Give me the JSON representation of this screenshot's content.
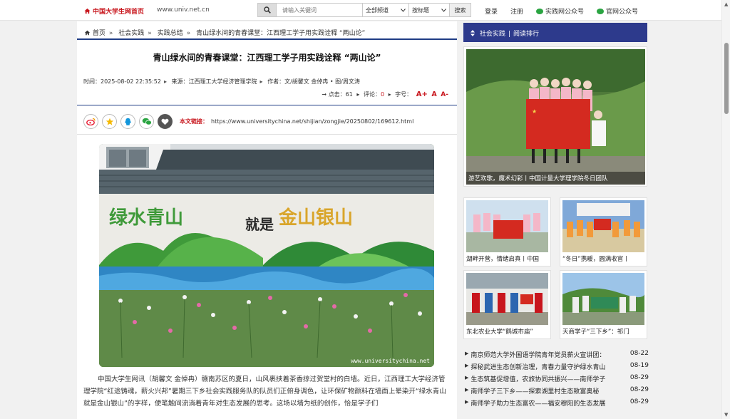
{
  "topbar": {
    "home_label": "中国大学生网首页",
    "domain": "www.univ.net.cn",
    "search_placeholder": "请输入关键词",
    "channel_select": "全部频道",
    "field_select": "按标题",
    "search_button": "搜索",
    "login": "登录",
    "register": "注册",
    "wechat_practice": "实践网公众号",
    "wechat_official": "官网公众号"
  },
  "breadcrumb": {
    "home": "首页",
    "c1": "社会实践",
    "c2": "实践总结",
    "current": "青山绿水间的青春课堂：江西理工学子用实践诠释 “两山论”"
  },
  "article": {
    "title": "青山绿水间的青春课堂：江西理工学子用实践诠释 “两山论”",
    "time": "时间：2025-08-02 22:35:52",
    "source": "来源：江西理工大学经济管理学院",
    "author": "作者：文/胡馨文 金倬冉 • 图/周文涛",
    "clicks_label": "点击：",
    "clicks": "61",
    "comments_label": "评论：",
    "comments": "0",
    "font_label": "字号：",
    "font_large": "A+",
    "font_mid": "A",
    "font_small": "A-",
    "link_label": "本文链接：",
    "link_url": "https://www.universitychina.net/shijian/zongjie/20250802/169612.html",
    "photo_watermark": "www.universitychina.net",
    "mural_text_left": "绿水青山",
    "mural_text_mid": "就是",
    "mural_text_right": "金山银山",
    "body": "中国大学生网讯（胡馨文 金倬冉）赣南苏区的夏日，山风裹挟着茶香掠过贺堂村的白墙。近日，江西理工大学经济管理学院“红途铸魂，薪火兴邦”暑期三下乡社会实践服务队的队员们正俯身调色，让环保矿物颜料在墙面上晕染开“绿水青山就是金山银山”的字样，使笔触间流淌着青年对生态发展的思考。这场以墙为纸的创作，恰是学子们"
  },
  "sidebar": {
    "tab1": "社会实践",
    "tab2": "阅读排行",
    "feature_caption": "游艺欢歌，魔术幻彩丨中国计量大学理学院冬日团队",
    "thumbs": [
      {
        "caption": "湖畔开营，情绪启真丨中国"
      },
      {
        "caption": "“冬日”携暖，圆满收官丨"
      },
      {
        "caption": "东北农业大学“鹤城市庙”"
      },
      {
        "caption": "天商学子“三下乡”：祁门"
      }
    ],
    "news": [
      {
        "title": "南京师范大学外国语学院青年党员薪火宣讲团：",
        "date": "08-22"
      },
      {
        "title": "探秘武进生态创新治理，青春力量守护绿水青山",
        "date": "08-19"
      },
      {
        "title": "生态筑基促增值，农旅协同共振兴——南师学子",
        "date": "08-29"
      },
      {
        "title": "南师学子三下乡——探索湖里村生态致富奥秘",
        "date": "08-29"
      },
      {
        "title": "南师学子助力生态富农——福安穆阳的生态发展",
        "date": "08-29"
      }
    ]
  },
  "colors": {
    "brand_red": "#c8161d",
    "nav_blue": "#2d3a8c",
    "rule_blue": "#1f3c85"
  }
}
